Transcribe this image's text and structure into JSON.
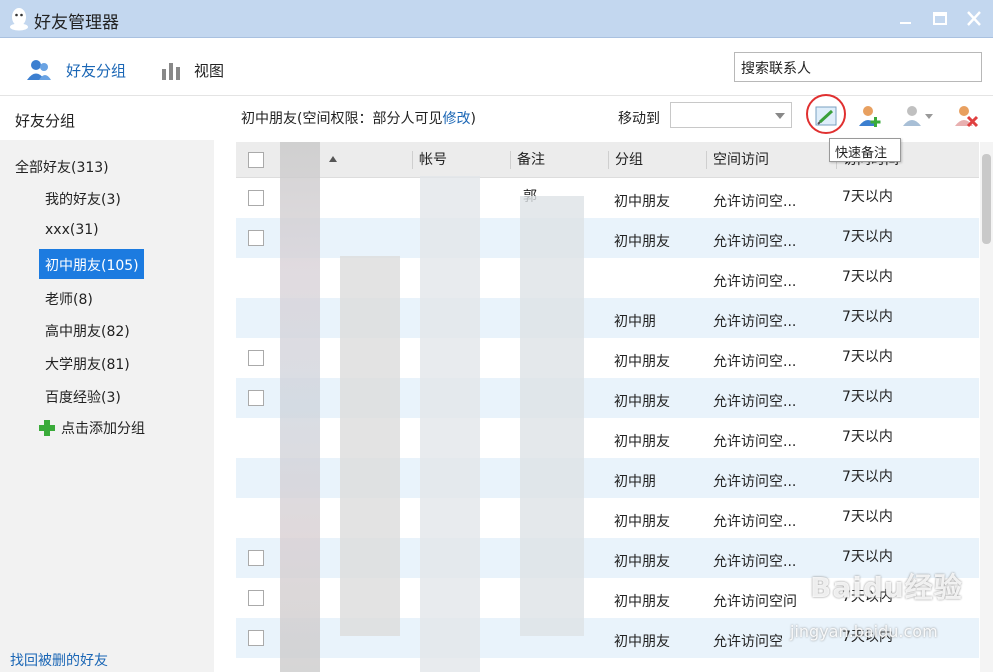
{
  "window": {
    "title": "好友管理器",
    "titlebar_color": "#c3d7ef"
  },
  "toolbar": {
    "friends_group_tab": "好友分组",
    "view_tab": "视图",
    "search_placeholder": "搜索联系人"
  },
  "sidebar": {
    "header": "好友分组",
    "all_friends": "全部好友(313)",
    "groups": [
      {
        "label": "我的好友(3)"
      },
      {
        "label": "xxx(31)"
      },
      {
        "label": "初中朋友(105)",
        "active": true
      },
      {
        "label": "老师(8)"
      },
      {
        "label": "高中朋友(82)"
      },
      {
        "label": "大学朋友(81)"
      },
      {
        "label": "百度经验(3)"
      }
    ],
    "add_group": "点击添加分组",
    "recover_deleted": "找回被删的好友",
    "active_color": "#1c7be0"
  },
  "main": {
    "permission_prefix": "初中朋友(空间权限：部分人可见",
    "permission_link": "修改",
    "permission_suffix": ")",
    "move_to_label": "移动到",
    "tooltip": "快速备注",
    "columns": [
      "帐号",
      "备注",
      "分组",
      "空间访问",
      "访问时间"
    ],
    "rows": [
      {
        "remark": "郭",
        "group": "初中朋友",
        "access": "允许访问空...",
        "time": "7天以内"
      },
      {
        "remark": "",
        "group": "初中朋友",
        "access": "允许访问空...",
        "time": "7天以内"
      },
      {
        "remark": "",
        "group": "",
        "access": "允许访问空...",
        "time": "7天以内"
      },
      {
        "remark": "",
        "group": "初中朋",
        "access": "允许访问空...",
        "time": "7天以内"
      },
      {
        "remark": "",
        "group": "初中朋友",
        "access": "允许访问空...",
        "time": "7天以内"
      },
      {
        "remark": "",
        "group": "初中朋友",
        "access": "允许访问空...",
        "time": "7天以内"
      },
      {
        "remark": "",
        "group": "初中朋友",
        "access": "允许访问空...",
        "time": "7天以内"
      },
      {
        "remark": "",
        "group": "初中朋",
        "access": "允许访问空...",
        "time": "7天以内"
      },
      {
        "remark": "",
        "group": "初中朋友",
        "access": "允许访问空...",
        "time": "7天以内"
      },
      {
        "remark": "",
        "group": "初中朋友",
        "access": "允许访问空...",
        "time": "7天以内"
      },
      {
        "remark": "",
        "group": "初中朋友",
        "access": "允许访问空问",
        "time": "7天以内"
      },
      {
        "remark": "",
        "group": "初中朋友",
        "access": "允许访问空",
        "time": "7天以内"
      }
    ]
  },
  "watermark": {
    "brand": "Baidu经验",
    "url": "jingyan.baidu.com"
  }
}
